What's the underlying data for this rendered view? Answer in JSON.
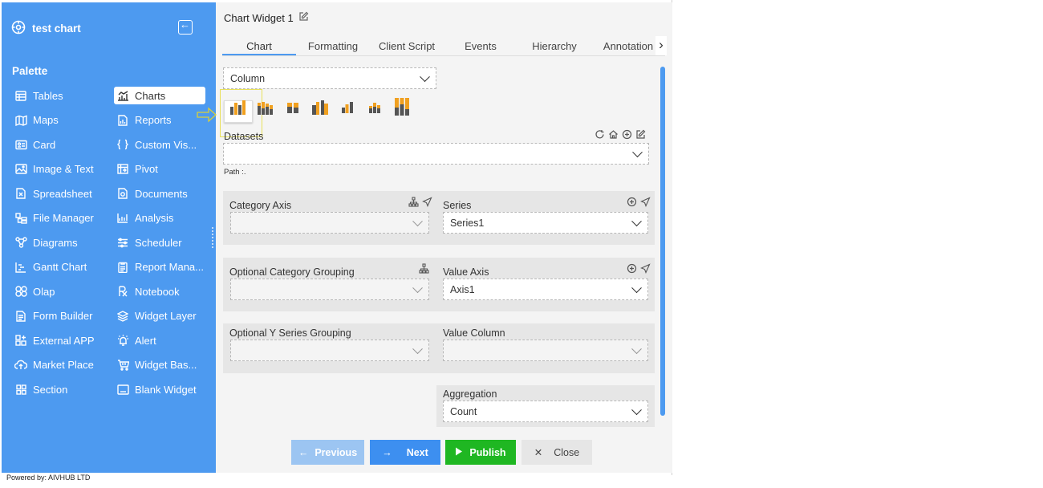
{
  "app": {
    "title": "test chart"
  },
  "palette": {
    "title": "Palette",
    "left_items": [
      {
        "label": "Tables",
        "icon": "table-icon"
      },
      {
        "label": "Maps",
        "icon": "map-icon"
      },
      {
        "label": "Card",
        "icon": "card-icon"
      },
      {
        "label": "Image & Text",
        "icon": "image-icon"
      },
      {
        "label": "Spreadsheet",
        "icon": "spreadsheet-icon"
      },
      {
        "label": "File Manager",
        "icon": "file-manager-icon"
      },
      {
        "label": "Diagrams",
        "icon": "diagram-icon"
      },
      {
        "label": "Gantt Chart",
        "icon": "gantt-icon"
      },
      {
        "label": "Olap",
        "icon": "olap-icon"
      },
      {
        "label": "Form Builder",
        "icon": "form-icon"
      },
      {
        "label": "External APP",
        "icon": "external-app-icon"
      },
      {
        "label": "Market Place",
        "icon": "cloud-upload-icon"
      },
      {
        "label": "Section",
        "icon": "section-grid-icon"
      }
    ],
    "right_items": [
      {
        "label": "Charts",
        "icon": "chart-line-icon",
        "active": true
      },
      {
        "label": "Reports",
        "icon": "report-icon"
      },
      {
        "label": "Custom Vis...",
        "icon": "braces-icon"
      },
      {
        "label": "Pivot",
        "icon": "pivot-icon"
      },
      {
        "label": "Documents",
        "icon": "document-icon"
      },
      {
        "label": "Analysis",
        "icon": "analysis-icon"
      },
      {
        "label": "Scheduler",
        "icon": "scheduler-icon"
      },
      {
        "label": "Report Mana...",
        "icon": "report-manager-icon"
      },
      {
        "label": "Notebook",
        "icon": "notebook-icon"
      },
      {
        "label": "Widget Layer",
        "icon": "layers-icon"
      },
      {
        "label": "Alert",
        "icon": "alert-icon"
      },
      {
        "label": "Widget Bas...",
        "icon": "basket-icon"
      },
      {
        "label": "Blank Widget",
        "icon": "blank-widget-icon"
      }
    ]
  },
  "widget": {
    "title": "Chart Widget 1",
    "tabs": [
      "Chart",
      "Formatting",
      "Client Script",
      "Events",
      "Hierarchy",
      "Annotation"
    ],
    "active_tab": "Chart",
    "chart_type": {
      "value": "Column"
    },
    "chart_variants": [
      "column-clustered",
      "column-stacked",
      "column-stacked-wide",
      "column-3d",
      "column-small",
      "column-stacked-small",
      "column-100-stacked"
    ],
    "datasets": {
      "label": "Datasets",
      "value": "",
      "path_label": "Path :."
    },
    "category_axis": {
      "label": "Category Axis",
      "value": ""
    },
    "series": {
      "label": "Series",
      "value": "Series1"
    },
    "optional_category_grouping": {
      "label": "Optional Category Grouping",
      "value": ""
    },
    "value_axis": {
      "label": "Value Axis",
      "value": "Axis1"
    },
    "optional_y_series_grouping": {
      "label": "Optional Y Series Grouping",
      "value": ""
    },
    "value_column": {
      "label": "Value Column",
      "value": ""
    },
    "aggregation": {
      "label": "Aggregation",
      "value": "Count"
    }
  },
  "actions": {
    "previous": "Previous",
    "next": "Next",
    "publish": "Publish",
    "close": "Close"
  },
  "colors": {
    "sidebar": "#4d9af0",
    "next": "#3d8ff0",
    "previous_disabled": "#9cc5f2",
    "publish": "#1fb722",
    "close": "#e6e6e6",
    "bar_dark": "#555555",
    "bar_orange": "#f0a020"
  },
  "footer": {
    "text": "Powered by: AIVHUB LTD"
  }
}
